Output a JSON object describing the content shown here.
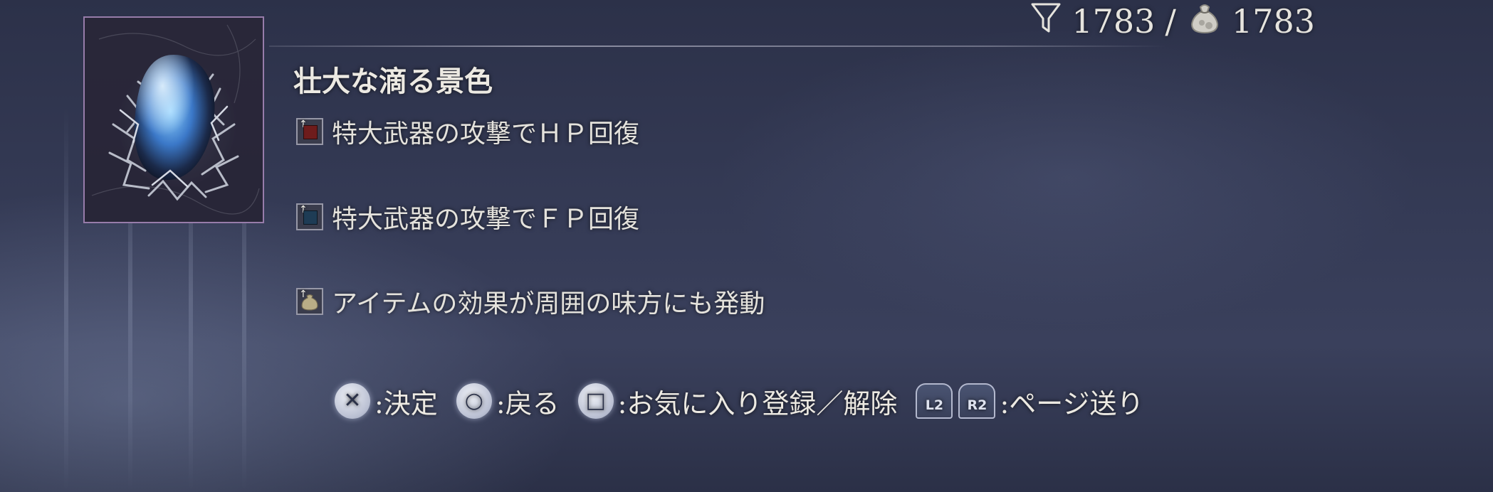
{
  "counts": {
    "filtered": "1783",
    "separator": "/",
    "total": "1783",
    "filter_icon": "funnel-icon",
    "bag_icon": "item-bag-icon"
  },
  "item": {
    "name": "壮大な滴る景色",
    "image_icon": "crystal-tear-icon",
    "effects": [
      {
        "text": "特大武器の攻撃でＨＰ回復",
        "icon": "red-square-icon",
        "color": "#6e1c1c"
      },
      {
        "text": "特大武器の攻撃でＦＰ回復",
        "icon": "blue-square-icon",
        "color": "#1e3c55"
      },
      {
        "text": "アイテムの効果が周囲の味方にも発動",
        "icon": "pouch-icon",
        "color": "#b9ad86"
      }
    ]
  },
  "controls": {
    "confirm": {
      "button": "✕",
      "label": ":決定"
    },
    "back": {
      "button": "○",
      "label": ":戻る"
    },
    "favorite": {
      "button": "□",
      "label": ":お気に入り登録／解除"
    },
    "page": {
      "l2": "L2",
      "r2": "R2",
      "label": ":ページ送り"
    }
  },
  "colors": {
    "frame_border": "#aa8cbe",
    "text": "#ece9e2",
    "background": "#353b56"
  }
}
